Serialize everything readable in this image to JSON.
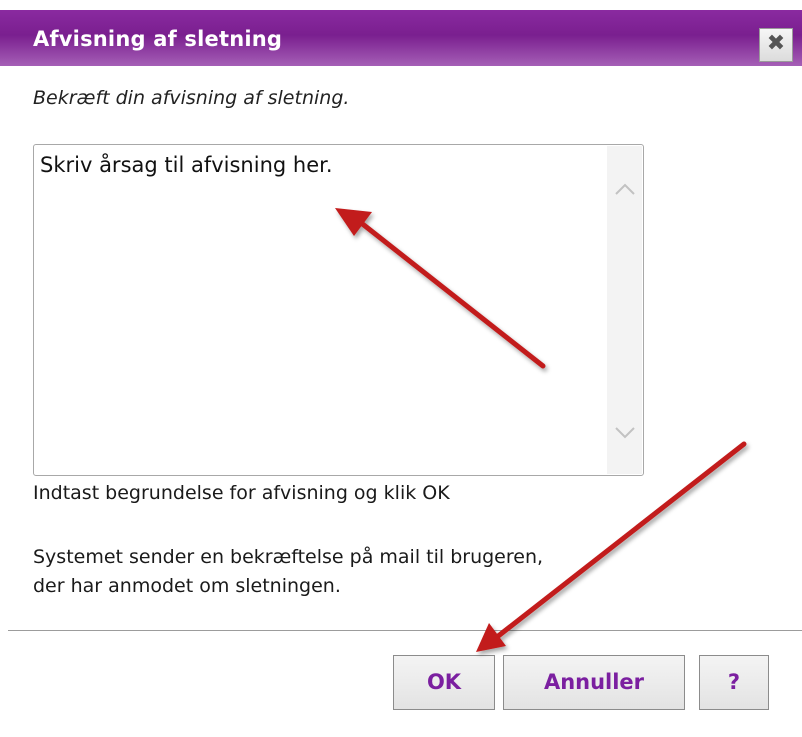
{
  "dialog": {
    "title": "Afvisning af sletning",
    "close_label": "✖"
  },
  "content": {
    "confirm_text": "Bekræft din afvisning af sletning.",
    "reason_value": "Skriv årsag til afvisning her.",
    "hint_text": "Indtast begrundelse for afvisning og klik OK",
    "info_line1": "Systemet sender en bekræftelse på mail til brugeren,",
    "info_line2": "der har anmodet om sletningen."
  },
  "buttons": {
    "ok_label": "OK",
    "cancel_label": "Annuller",
    "help_label": "?"
  },
  "colors": {
    "title_bar": "#7a1f8f",
    "button_text": "#7b1fa0",
    "annotation_arrow": "#c21a1a"
  },
  "icons": {
    "close": "close-icon",
    "scroll_up": "chevron-up-icon",
    "scroll_down": "chevron-down-icon",
    "annotation": "arrow-annotation-icon"
  }
}
